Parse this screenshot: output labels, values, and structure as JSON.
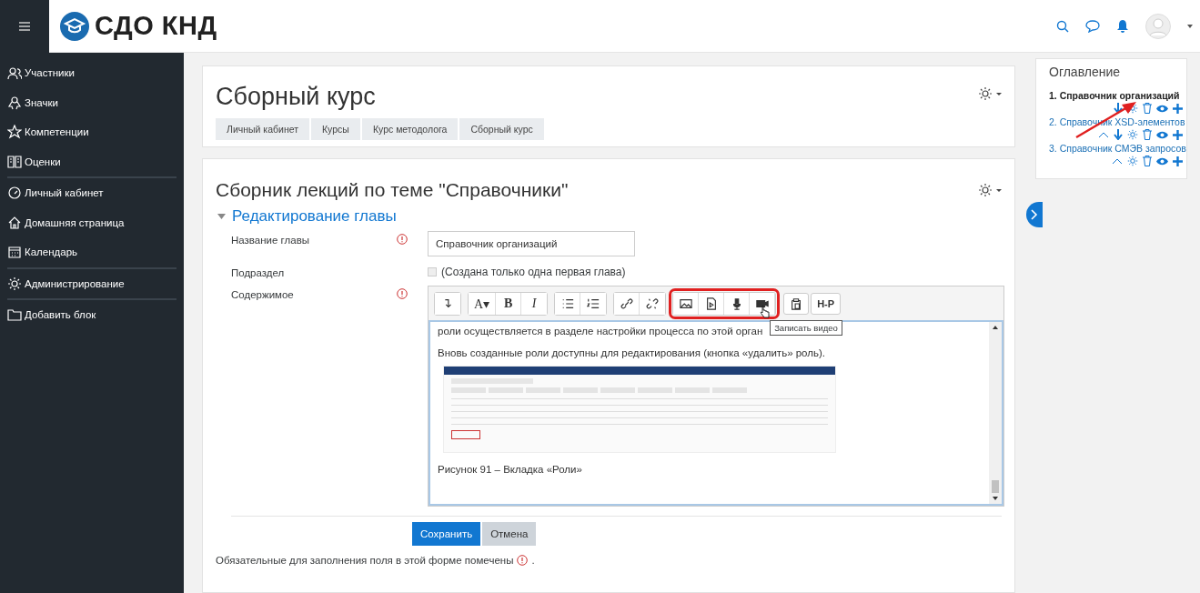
{
  "header": {
    "logo_text": "СДО КНД"
  },
  "sidebar": {
    "sections": [
      [
        {
          "label": "Участники"
        },
        {
          "label": "Значки"
        },
        {
          "label": "Компетенции"
        },
        {
          "label": "Оценки"
        }
      ],
      [
        {
          "label": "Личный кабинет"
        },
        {
          "label": "Домашняя страница"
        },
        {
          "label": "Календарь"
        }
      ],
      [
        {
          "label": "Администрирование"
        }
      ],
      [
        {
          "label": "Добавить блок"
        }
      ]
    ]
  },
  "course": {
    "title": "Сборный курс",
    "breadcrumbs": [
      "Личный кабинет",
      "Курсы",
      "Курс методолога",
      "Сборный курс"
    ]
  },
  "book": {
    "title": "Сборник лекций по теме \"Справочники\"",
    "section_title": "Редактирование главы",
    "expanded": true,
    "fields": [
      {
        "kind": "text",
        "label": "Название главы",
        "required": true,
        "value": "Справочник организаций"
      },
      {
        "kind": "checkbox",
        "label": "Подраздел",
        "required": false,
        "checked": false,
        "disabled": true,
        "text": "(Создана только одна первая глава)"
      },
      {
        "kind": "editor",
        "label": "Содержимое",
        "required": true
      }
    ],
    "toolbar": [
      {
        "highlighted": false,
        "buttons": [
          {
            "kind": "collapse"
          }
        ]
      },
      {
        "highlighted": false,
        "buttons": [
          {
            "kind": "font",
            "text": "A▾"
          },
          {
            "kind": "bold",
            "text": "B"
          },
          {
            "kind": "italic",
            "text": "I"
          }
        ]
      },
      {
        "highlighted": false,
        "buttons": [
          {
            "kind": "bullets"
          },
          {
            "kind": "numbers"
          }
        ]
      },
      {
        "highlighted": false,
        "buttons": [
          {
            "kind": "link"
          },
          {
            "kind": "unlink"
          }
        ]
      },
      {
        "highlighted": true,
        "buttons": [
          {
            "kind": "image"
          },
          {
            "kind": "media"
          },
          {
            "kind": "audio"
          },
          {
            "kind": "video"
          }
        ]
      },
      {
        "highlighted": false,
        "buttons": [
          {
            "kind": "paste"
          },
          {
            "kind": "h5p",
            "text": "H-P"
          }
        ]
      }
    ],
    "tooltip": "Записать видео",
    "content": [
      {
        "kind": "text",
        "text": "роли осуществляется в разделе настройки процесса по этой орган"
      },
      {
        "kind": "text",
        "text": "Вновь созданные роли доступны для редактирования (кнопка «удалить» роль)."
      },
      {
        "kind": "image"
      },
      {
        "kind": "text",
        "text": "Рисунок 91 – Вкладка «Роли»"
      }
    ],
    "buttons": [
      {
        "label": "Сохранить",
        "primary": true
      },
      {
        "label": "Отмена",
        "primary": false
      }
    ],
    "required_note": "Обязательные для заполнения поля в этой форме помечены",
    "required_note_end": "."
  },
  "toc": {
    "title": "Оглавление",
    "items": [
      {
        "label": "1. Справочник организаций",
        "selected": true,
        "can_move_up": false,
        "can_move_down": true
      },
      {
        "label": "2. Справочник XSD-элементов",
        "selected": false,
        "can_move_up": true,
        "can_move_down": true
      },
      {
        "label": "3. Справочник СМЭВ запросов",
        "selected": false,
        "can_move_up": true,
        "can_move_down": false
      }
    ]
  }
}
